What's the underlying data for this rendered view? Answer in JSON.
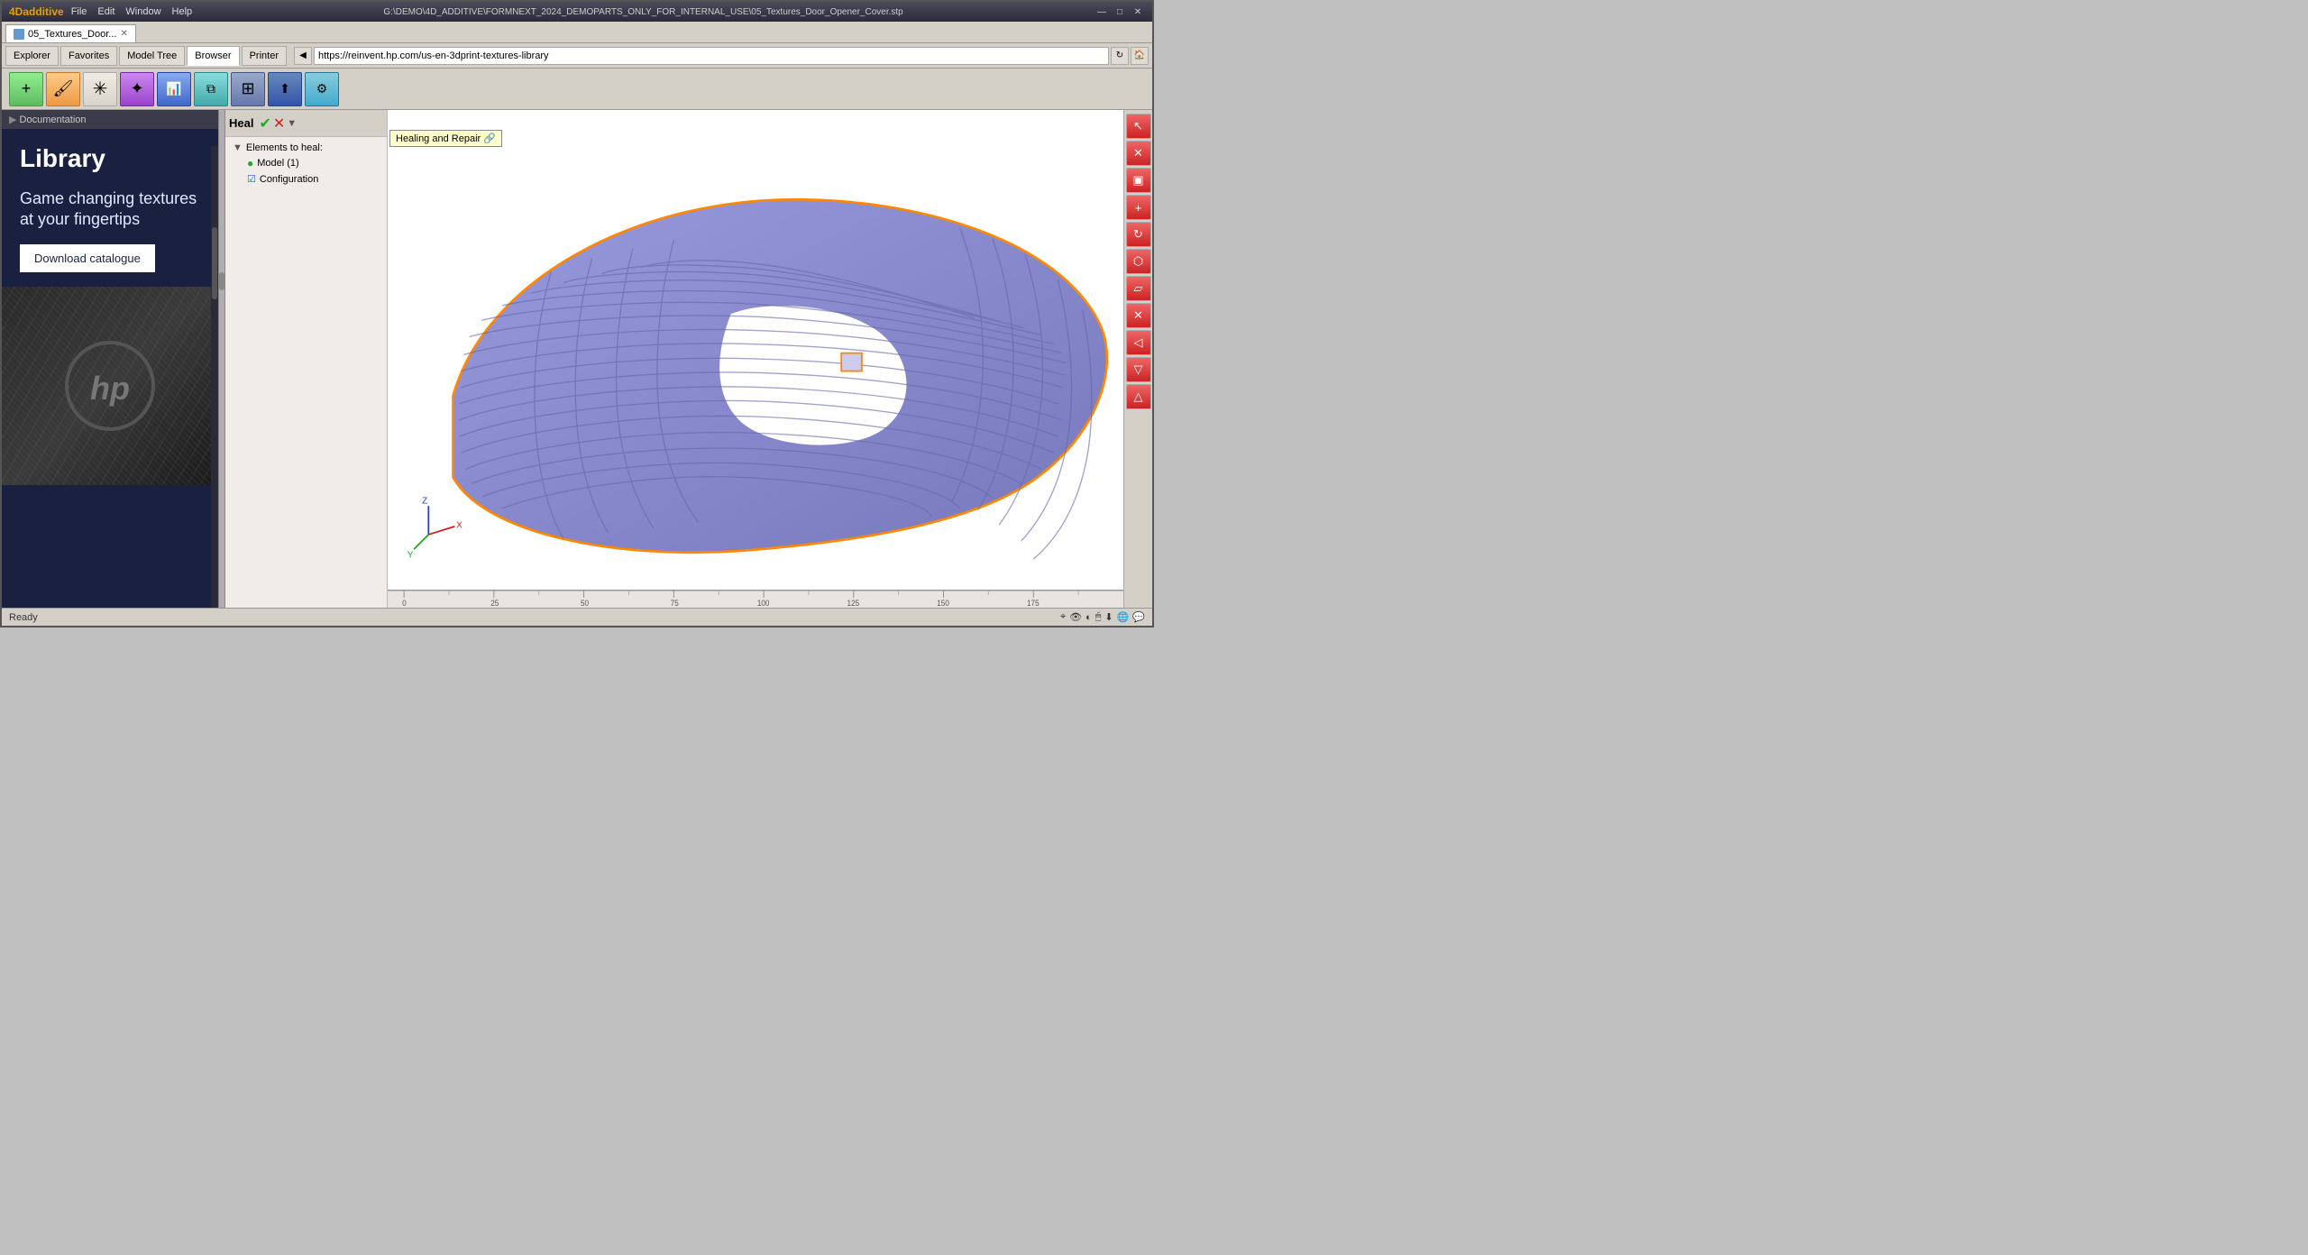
{
  "app": {
    "title": "G:\\DEMO\\4D_ADDITIVE\\FORMNEXT_2024_DEMOPARTS_ONLY_FOR_INTERNAL_USE\\05_Textures_Door_Opener_Cover.stp",
    "logo": "4Dadditive",
    "menu": [
      "File",
      "Edit",
      "Window",
      "Help"
    ],
    "window_controls": [
      "—",
      "□",
      "✕"
    ]
  },
  "tab": {
    "label": "05_Textures_Door...",
    "close": "✕"
  },
  "nav_tabs": [
    "Explorer",
    "Favorites",
    "Model Tree",
    "Browser",
    "Printer"
  ],
  "address_bar": {
    "url": "https://reinvent.hp.com/us-en-3dprint-textures-library"
  },
  "browser": {
    "breadcrumb": "Documentation",
    "title": "Library",
    "tagline": "Game changing textures\nat your fingertips",
    "download_btn": "Download catalogue"
  },
  "heal_panel": {
    "label": "Heal",
    "elements_label": "Elements to heal:",
    "model_item": "Model (1)",
    "config_item": "Configuration"
  },
  "tooltip": {
    "healing_repair": "Healing and Repair"
  },
  "toolbar_icons": [
    {
      "name": "add-green",
      "symbol": "+",
      "style": "green"
    },
    {
      "name": "brush",
      "symbol": "🖌",
      "style": "orange"
    },
    {
      "name": "asterisk",
      "symbol": "✳",
      "style": ""
    },
    {
      "name": "star4",
      "symbol": "✦",
      "style": "purple"
    },
    {
      "name": "chart",
      "symbol": "📊",
      "style": "blue"
    },
    {
      "name": "layers",
      "symbol": "⧉",
      "style": "teal"
    },
    {
      "name": "grid",
      "symbol": "⊞",
      "style": "gray-blue"
    },
    {
      "name": "export",
      "symbol": "⬆",
      "style": "dark-blue"
    },
    {
      "name": "settings",
      "symbol": "⚙",
      "style": "cyan"
    }
  ],
  "right_toolbar_icons": [
    {
      "name": "cursor",
      "symbol": "↖",
      "color": "#cc4444"
    },
    {
      "name": "close-x",
      "symbol": "✕",
      "color": "#cc4444"
    },
    {
      "name": "front-view",
      "symbol": "▣",
      "color": "#cc4444"
    },
    {
      "name": "add-plus",
      "symbol": "+",
      "color": "#cc4444"
    },
    {
      "name": "rotate",
      "symbol": "↻",
      "color": "#cc4444"
    },
    {
      "name": "cube",
      "symbol": "⬡",
      "color": "#cc4444"
    },
    {
      "name": "flatten",
      "symbol": "▱",
      "color": "#cc4444"
    },
    {
      "name": "cut",
      "symbol": "✕",
      "color": "#cc4444"
    },
    {
      "name": "hide",
      "symbol": "◁",
      "color": "#cc4444"
    },
    {
      "name": "collapse",
      "symbol": "▽",
      "color": "#cc4444"
    },
    {
      "name": "up",
      "symbol": "△",
      "color": "#cc4444"
    }
  ],
  "status_bar": {
    "text": "Ready"
  },
  "ruler": {
    "marks": [
      "0",
      "25",
      "50",
      "75",
      "100",
      "125",
      "150",
      "175"
    ]
  },
  "axis": {
    "x": "X",
    "y": "Y",
    "z": "Z"
  }
}
